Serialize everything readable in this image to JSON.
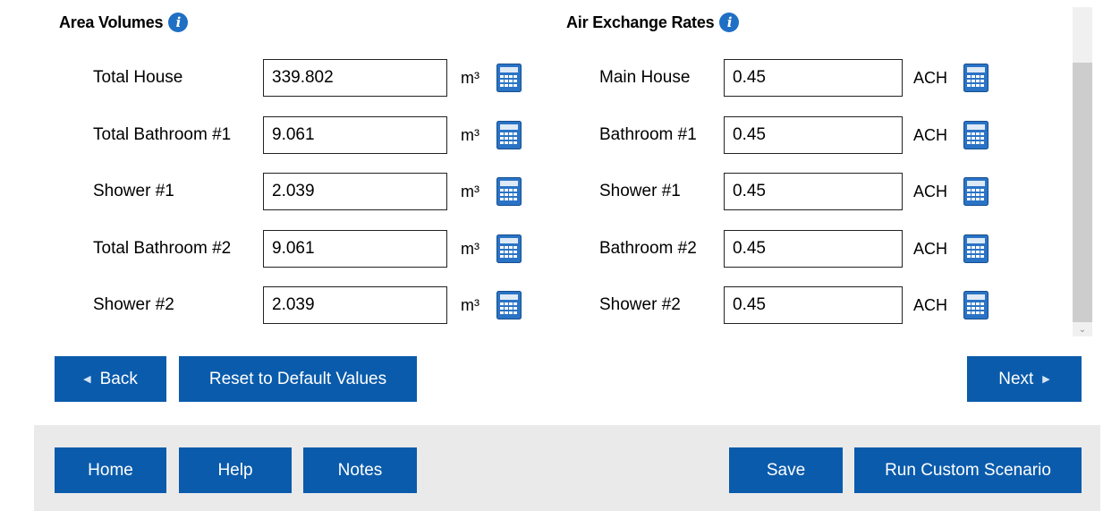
{
  "area_volumes": {
    "title": "Area Volumes",
    "rows": [
      {
        "label": "Total House",
        "value": "339.802",
        "unit": "m³"
      },
      {
        "label": "Total Bathroom #1",
        "value": "9.061",
        "unit": "m³"
      },
      {
        "label": "Shower #1",
        "value": "2.039",
        "unit": "m³"
      },
      {
        "label": "Total Bathroom #2",
        "value": "9.061",
        "unit": "m³"
      },
      {
        "label": "Shower #2",
        "value": "2.039",
        "unit": "m³"
      }
    ]
  },
  "air_exchange": {
    "title": "Air Exchange Rates",
    "rows": [
      {
        "label": "Main House",
        "value": "0.45",
        "unit": "ACH"
      },
      {
        "label": "Bathroom #1",
        "value": "0.45",
        "unit": "ACH"
      },
      {
        "label": "Shower #1",
        "value": "0.45",
        "unit": "ACH"
      },
      {
        "label": "Bathroom #2",
        "value": "0.45",
        "unit": "ACH"
      },
      {
        "label": "Shower #2",
        "value": "0.45",
        "unit": "ACH"
      }
    ]
  },
  "icons": {
    "info": "info-icon",
    "calculator": "calculator-icon",
    "back_arrow": "triangle-left-icon",
    "next_arrow": "triangle-right-icon",
    "scroll_down": "chevron-down-icon"
  },
  "nav": {
    "back_label": "Back",
    "reset_label": "Reset to Default Values",
    "next_label": "Next"
  },
  "footer": {
    "home_label": "Home",
    "help_label": "Help",
    "notes_label": "Notes",
    "save_label": "Save",
    "run_label": "Run Custom Scenario"
  },
  "colors": {
    "button_bg": "#0a5bab",
    "info_icon": "#1f6fc4",
    "footer_bg": "#eaeaea"
  }
}
